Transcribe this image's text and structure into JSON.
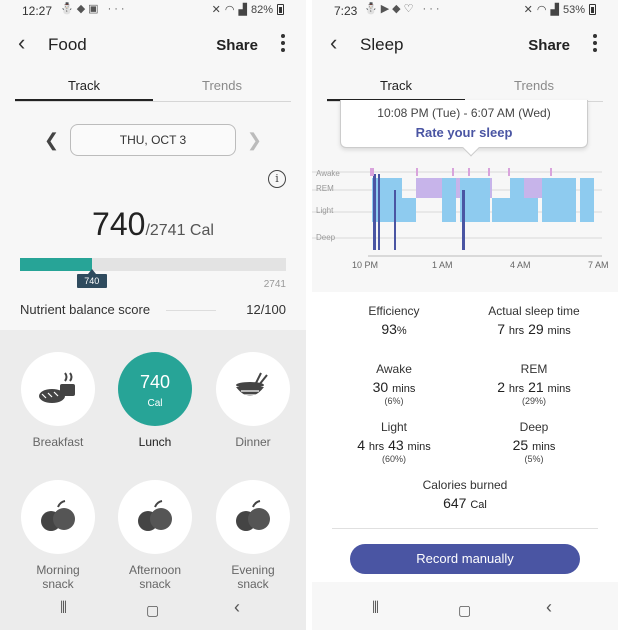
{
  "food": {
    "status": {
      "time": "12:27",
      "battery": "82%"
    },
    "title": "Food",
    "share": "Share",
    "tabs": [
      "Track",
      "Trends"
    ],
    "date": "THU, OCT 3",
    "calories": {
      "eaten": "740",
      "goal_text": "/2741 Cal",
      "goal": "2741",
      "marker": "740",
      "fraction": 0.27
    },
    "nutrient": {
      "label": "Nutrient balance score",
      "score": "12/100"
    },
    "meals": [
      {
        "label": "Breakfast"
      },
      {
        "label": "Lunch",
        "value": "740",
        "unit": "Cal"
      },
      {
        "label": "Dinner"
      },
      {
        "label": "Morning\nsnack"
      },
      {
        "label": "Afternoon\nsnack"
      },
      {
        "label": "Evening\nsnack"
      }
    ],
    "colors": {
      "accent": "#27a497",
      "marker": "#2f4b5e"
    }
  },
  "sleep": {
    "status": {
      "time": "7:23",
      "battery": "53%"
    },
    "title": "Sleep",
    "share": "Share",
    "tabs": [
      "Track",
      "Trends"
    ],
    "range": "10:08 PM (Tue) - 6:07 AM (Wed)",
    "rate": "Rate your sleep",
    "stages": [
      "Awake",
      "REM",
      "Light",
      "Deep"
    ],
    "xticks": [
      "10 PM",
      "1 AM",
      "4 AM",
      "7 AM"
    ],
    "stats": {
      "efficiency": {
        "label": "Efficiency",
        "value": "93",
        "unit": "%"
      },
      "actual": {
        "label": "Actual sleep time",
        "h": "7",
        "hu": "hrs",
        "m": "29",
        "mu": "mins"
      },
      "awake": {
        "label": "Awake",
        "m": "30",
        "mu": "mins",
        "pct": "(6%)"
      },
      "rem": {
        "label": "REM",
        "h": "2",
        "hu": "hrs",
        "m": "21",
        "mu": "mins",
        "pct": "(29%)"
      },
      "light": {
        "label": "Light",
        "h": "4",
        "hu": "hrs",
        "m": "43",
        "mu": "mins",
        "pct": "(60%)"
      },
      "deep": {
        "label": "Deep",
        "m": "25",
        "mu": "mins",
        "pct": "(5%)"
      },
      "calories": {
        "label": "Calories burned",
        "value": "647",
        "unit": "Cal"
      }
    },
    "button": "Record manually",
    "colors": {
      "accent": "#4a55a3",
      "light": "#8ecbef",
      "rem": "#c7b4ea",
      "deep": "#4a55a3",
      "awake": "#d9a4dc"
    }
  }
}
